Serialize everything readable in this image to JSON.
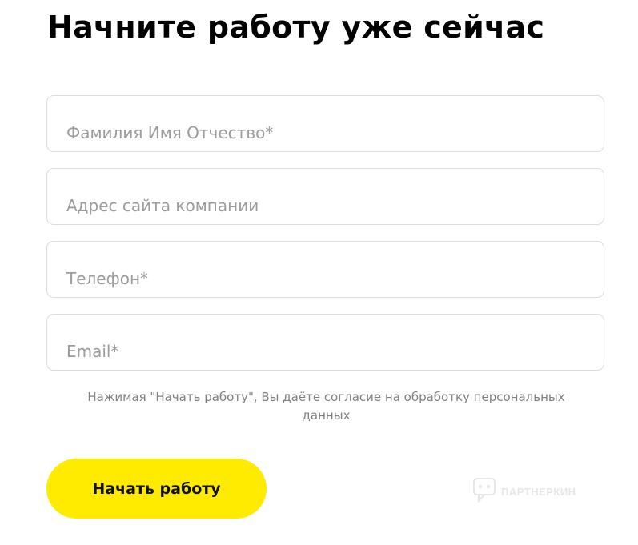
{
  "form": {
    "title": "Начните работу уже сейчас",
    "fields": [
      {
        "name": "full-name",
        "placeholder": "Фамилия Имя Отчество*",
        "value": ""
      },
      {
        "name": "company-website",
        "placeholder": "Адрес сайта компании",
        "value": ""
      },
      {
        "name": "phone",
        "placeholder": "Телефон*",
        "value": ""
      },
      {
        "name": "email",
        "placeholder": "Email*",
        "value": ""
      }
    ],
    "consent_text": "Нажимая \"Начать работу\", Вы даёте согласие на обработку персональных данных",
    "submit_label": "Начать работу"
  },
  "watermark": {
    "text": "ПАРТНЕРКИН",
    "icon": "chat-bubble-icon"
  },
  "colors": {
    "accent": "#ffeb00",
    "field_border": "#dcdcdc",
    "placeholder": "#9b9b9b",
    "consent_text": "#7f7f7f"
  }
}
